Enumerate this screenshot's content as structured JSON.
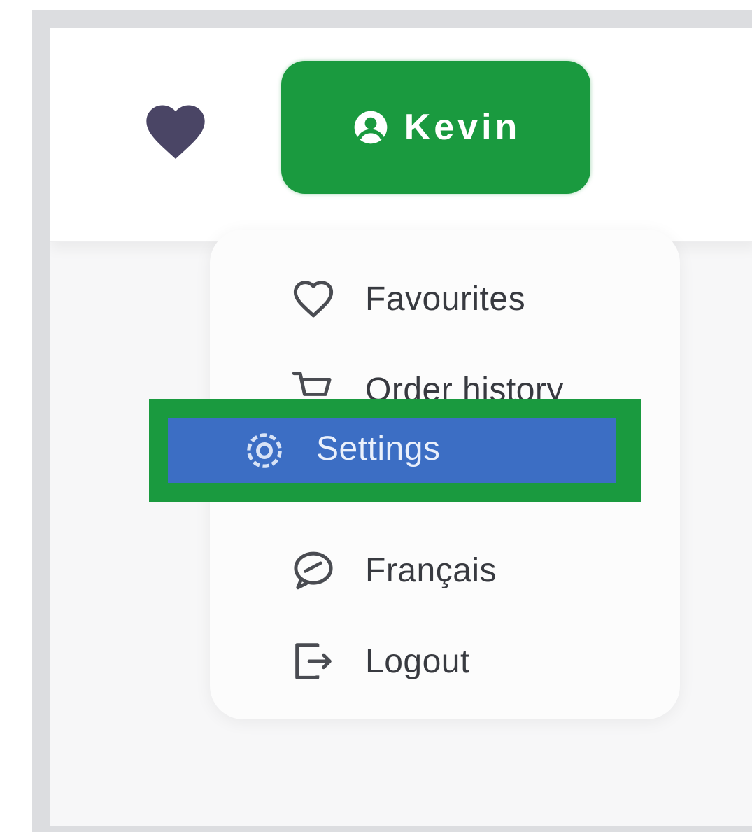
{
  "header": {
    "favourites_icon": "heart-filled-icon",
    "user_button": {
      "icon": "user-circle-icon",
      "label": "Kevin"
    }
  },
  "menu": {
    "items": [
      {
        "label": "Favourites",
        "icon": "heart-outline-icon"
      },
      {
        "label": "Order history",
        "icon": "cart-icon"
      },
      {
        "label": "Settings",
        "icon": "gear-icon",
        "highlighted": true
      },
      {
        "label": "Français",
        "icon": "chat-icon"
      },
      {
        "label": "Logout",
        "icon": "logout-icon"
      }
    ]
  },
  "colors": {
    "brand_green": "#1a9a3f",
    "highlight_blue": "#3c6ec4",
    "heart": "#4a4565",
    "menu_text": "#383a40"
  }
}
